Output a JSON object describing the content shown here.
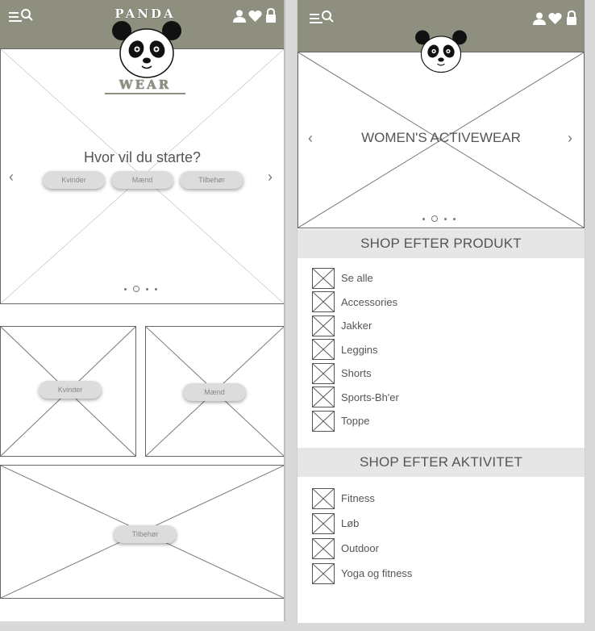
{
  "brand": {
    "top": "PANDA",
    "bottom": "WEAR"
  },
  "colors": {
    "header": "#8f8f80",
    "band": "#e6e6e6",
    "line": "#666666"
  },
  "icons": {
    "menu": "menu-search-icon",
    "user": "user-icon",
    "heart": "heart-icon",
    "lock": "lock-icon",
    "logo": "panda-logo-icon"
  },
  "home": {
    "hero_title": "Hvor vil du starte?",
    "hero_buttons": [
      "Kvinder",
      "Mænd",
      "Tilbehør"
    ],
    "arrow_prev": "‹",
    "arrow_next": "›",
    "tiles": {
      "women": "Kvinder",
      "men": "Mænd",
      "accessories": "Tilbehør"
    }
  },
  "category": {
    "hero_title": "WOMEN'S ACTIVEWEAR",
    "arrow_prev": "‹",
    "arrow_next": "›",
    "product_heading": "SHOP EFTER PRODUKT",
    "products": [
      "Se alle",
      "Accessories",
      "Jakker",
      "Leggins",
      "Shorts",
      "Sports-Bh'er",
      "Toppe"
    ],
    "activity_heading": "SHOP EFTER AKTIVITET",
    "activities": [
      "Fitness",
      "Løb",
      "Outdoor",
      "Yoga og fitness"
    ]
  }
}
